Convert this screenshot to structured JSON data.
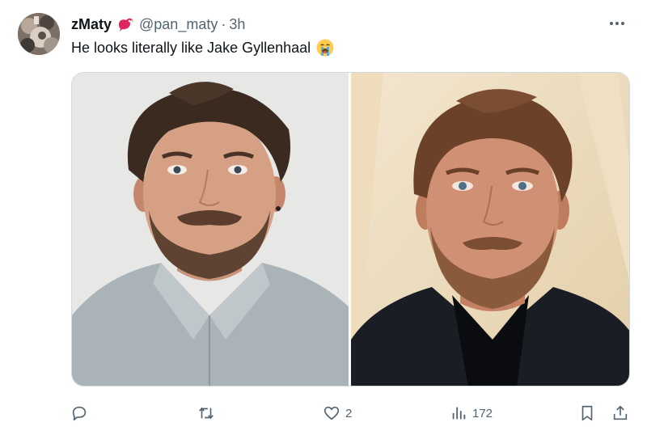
{
  "author": {
    "display_name": "zMaty",
    "handle": "@pan_maty",
    "separator": "·",
    "time": "3h",
    "badge_icon": "red-bird-icon"
  },
  "tweet": {
    "text": "He looks literally like Jake Gyllenhaal",
    "emoji_icon": "loudly-crying-face-icon"
  },
  "media": [
    {
      "icon": "photo-bearded-man-grey-shirt"
    },
    {
      "icon": "photo-bearded-man-dark-suit"
    }
  ],
  "actions": {
    "reply": {
      "icon": "reply-icon",
      "count": ""
    },
    "repost": {
      "icon": "repost-icon",
      "count": ""
    },
    "like": {
      "icon": "like-icon",
      "count": "2"
    },
    "views": {
      "icon": "views-icon",
      "count": "172"
    },
    "bookmark": {
      "icon": "bookmark-icon"
    },
    "share": {
      "icon": "share-icon"
    }
  },
  "colors": {
    "text": "#0f1419",
    "secondary": "#536471",
    "border": "#cfd9de",
    "badge": "#e0245e"
  }
}
